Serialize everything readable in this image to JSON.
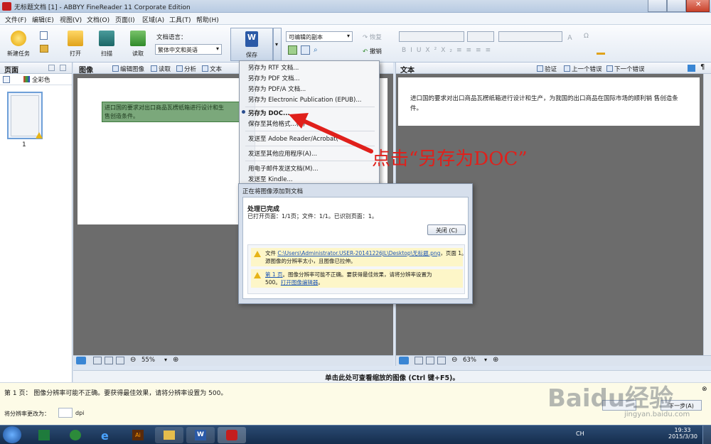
{
  "window": {
    "title": "无标题文档 [1] - ABBYY FineReader 11 Corporate Edition"
  },
  "menu": [
    "文件(F)",
    "编辑(E)",
    "视图(V)",
    "文档(O)",
    "页面(I)",
    "区域(A)",
    "工具(T)",
    "帮助(H)"
  ],
  "toolbar": {
    "new_task": "新建任务",
    "open": "打开",
    "scan": "扫描",
    "read": "读取",
    "doc_language_label": "文档语言：",
    "doc_language_value": "繁体中文和英语",
    "save": "保存",
    "save_mode": "可编辑的副本",
    "restore": "恢复",
    "undo": "撤销"
  },
  "pages_pane": {
    "title": "页面",
    "color_mode": "全彩色",
    "page_number": "1"
  },
  "image_pane": {
    "title": "图像",
    "edit_image": "编辑图像",
    "read": "读取",
    "analyze": "分析",
    "text": "文本",
    "highlight_text_1": "进口国的要求对出口商品瓦楞纸箱进行设计和生",
    "highlight_text_2": "售创造条件。",
    "zoom": "55%"
  },
  "text_pane": {
    "title": "文本",
    "verify": "验证",
    "prev_error": "上一个错误",
    "next_error": "下一个错误",
    "content": "进口国的要求对出口商品瓦楞纸箱进行设计和生产，为我国的出口商品在国际市场的顺利销 售创造条件。",
    "zoom": "63%"
  },
  "save_menu": {
    "items": [
      "另存为 RTF 文档...",
      "另存为 PDF 文档...",
      "另存为 PDF/A 文档...",
      "另存为 Electronic Publication (EPUB)...",
      "另存为 DOC...",
      "保存至其他格式...(V)",
      "发送至 Adobe Reader/Acrobat(",
      "发送至其他应用程序(A)...",
      "用电子邮件发送文档(M)...",
      "发送至 Kindle..."
    ]
  },
  "annotation": "点击“另存为DOC”",
  "dialog": {
    "title": "正在将图像添加到文档",
    "status_title": "处理已完成",
    "status_line": "已打开页面：1/1页；文件：1/1。已识别页面：1。",
    "close_button": "关闭 (C)",
    "warn1_prefix": "文件 ",
    "warn1_path": "C:\\Users\\Administrator.USER-20141226JL\\Desktop\\无标题.png",
    "warn1_suffix": "，页面 1。",
    "warn1_line2": "源图像的分辨率太小，且图像已拉伸。",
    "warn2_link": "第 1 页",
    "warn2_text": "。图像分辨率可能不正确。要获得最佳效果，请将分辨率设置为",
    "warn2_line2_prefix": "500。",
    "warn2_link2": "打开图像编辑器",
    "warn2_line2_suffix": "。"
  },
  "zoom_bar": {
    "text": "单击此处可查看缩放的图像 (Ctrl 键+F5)。"
  },
  "status": {
    "message": "第 1 页： 图像分辨率可能不正确。要获得最佳效果，请将分辨率设置为 500。",
    "resolution_label": "将分辨率更改为：",
    "dpi_unit": "dpi",
    "next_step": "下一步(A)"
  },
  "watermark": {
    "brand": "Baidu经验",
    "url": "jingyan.baidu.com"
  },
  "taskbar": {
    "time": "19:33",
    "date": "2015/3/30",
    "lang": "CH"
  },
  "colors": {
    "accent": "#e0201b",
    "highlight": "#7ba87b"
  }
}
